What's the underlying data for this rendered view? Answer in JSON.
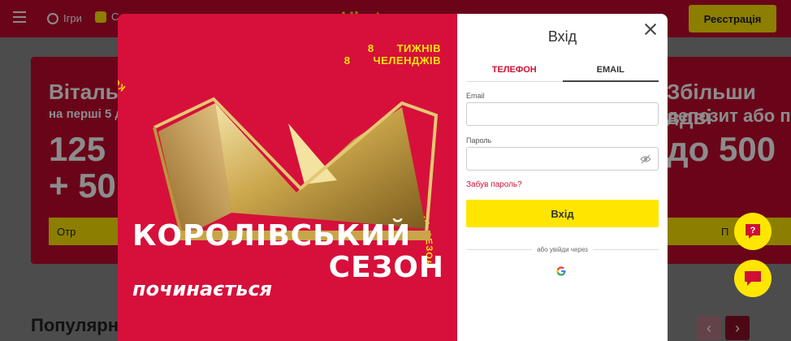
{
  "header": {
    "nav_games": "Ігри",
    "nav_second": "С",
    "logo": "Ubet",
    "register_label": "Реєстрація"
  },
  "hero": {
    "left_title": "Вітальн",
    "left_sub": "на перші 5 д",
    "left_big1": "125",
    "left_big2": "+ 50",
    "left_btn": "Отр",
    "right_title": "Збільши вдві",
    "right_sub": "депозит або п",
    "right_big": "до 500",
    "right_btn": "П"
  },
  "popular_heading": "Популярн",
  "promo": {
    "weeks_num": "8",
    "weeks_text": "ТИЖНІВ",
    "challenges_num": "8",
    "challenges_text": "ЧЕЛЕНДЖІВ",
    "ring_text": "КОРОЛІВСЬКИЙ СЕЗОН",
    "title_line1": "КОРОЛІВСЬКИЙ",
    "title_line2": "СЕЗОН",
    "title_line3": "починається"
  },
  "login": {
    "title": "Вхід",
    "tab_phone": "ТЕЛЕФОН",
    "tab_email": "EMAIL",
    "email_label": "Email",
    "email_value": "",
    "password_label": "Пароль",
    "password_value": "",
    "forgot": "Забув пароль?",
    "submit": "Вхід",
    "or_text": "або увійди через"
  },
  "colors": {
    "brand_red": "#c20a2f",
    "promo_red": "#d6103a",
    "accent_yellow": "#ffe600"
  },
  "icons": {
    "close": "close-icon",
    "eye": "eye-off-icon",
    "google": "google-icon",
    "help": "question-chat-icon",
    "chat": "chat-icon"
  }
}
